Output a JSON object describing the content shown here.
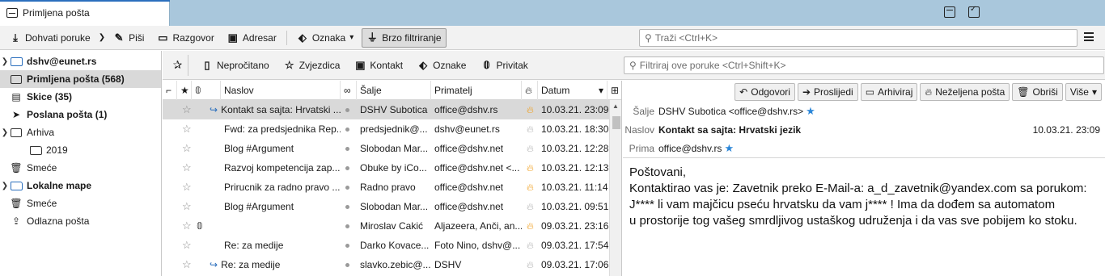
{
  "tab": {
    "title": "Primljena pošta"
  },
  "toolbar": {
    "get_messages": "Dohvati poruke",
    "write": "Piši",
    "chat": "Razgovor",
    "address_book": "Adresar",
    "tag": "Oznaka",
    "quick_filter": "Brzo filtriranje",
    "search_placeholder": "Traži <Ctrl+K>"
  },
  "folders": {
    "account": "dshv@eunet.rs",
    "inbox": "Primljena pošta (568)",
    "drafts": "Skice (35)",
    "sent": "Poslana pošta (1)",
    "archive": "Arhiva",
    "archive_2019": "2019",
    "trash": "Smeće",
    "local": "Lokalne mape",
    "local_trash": "Smeće",
    "outbox": "Odlazna pošta"
  },
  "quickfilter": {
    "unread": "Nepročitano",
    "starred": "Zvjezdica",
    "contact": "Kontakt",
    "tags": "Oznake",
    "attachment": "Privitak",
    "filter_placeholder": "Filtriraj ove poruke <Ctrl+Shift+K>"
  },
  "columns": {
    "subject": "Naslov",
    "sender": "Šalje",
    "recipient": "Primatelj",
    "date": "Datum"
  },
  "messages": [
    {
      "subject": "Kontakt sa sajta: Hrvatski ...",
      "sender": "DSHV Subotica",
      "recipient": "office@dshv.rs",
      "date": "10.03.21. 23:09",
      "replied": true,
      "junk": "hot"
    },
    {
      "subject": "Fwd: za predsjednika Rep...",
      "sender": "predsjednik@...",
      "recipient": "dshv@eunet.rs",
      "date": "10.03.21. 18:30",
      "replied": false,
      "junk": "cold"
    },
    {
      "subject": "Blog #Argument",
      "sender": "Slobodan Mar...",
      "recipient": "office@dshv.net",
      "date": "10.03.21. 12:28",
      "replied": false,
      "junk": "cold"
    },
    {
      "subject": "Razvoj kompetencija zap...",
      "sender": "Obuke by iCo...",
      "recipient": "office@dshv.net <...",
      "date": "10.03.21. 12:13",
      "replied": false,
      "junk": "hot"
    },
    {
      "subject": "Prirucnik za radno pravo ...",
      "sender": "Radno pravo",
      "recipient": "office@dshv.net",
      "date": "10.03.21. 11:14",
      "replied": false,
      "junk": "hot"
    },
    {
      "subject": "Blog #Argument",
      "sender": "Slobodan Mar...",
      "recipient": "office@dshv.net",
      "date": "10.03.21. 09:51",
      "replied": false,
      "junk": "cold"
    },
    {
      "subject": "",
      "sender": "Miroslav Cakić",
      "recipient": "Aljazeera, Anči, an...",
      "date": "09.03.21. 23:16",
      "replied": false,
      "junk": "hot",
      "attachment": true
    },
    {
      "subject": "Re: za medije",
      "sender": "Darko Kovace...",
      "recipient": "Foto Nino, dshv@...",
      "date": "09.03.21. 17:54",
      "replied": false,
      "junk": "cold"
    },
    {
      "subject": "Re: za medije",
      "sender": "slavko.zebic@...",
      "recipient": "DSHV",
      "date": "09.03.21. 17:06",
      "replied": true,
      "junk": "cold"
    }
  ],
  "message_view": {
    "buttons": {
      "reply": "Odgovori",
      "forward": "Proslijedi",
      "archive": "Arhiviraj",
      "junk": "Neželjena pošta",
      "delete": "Obriši",
      "more": "Više"
    },
    "from_label": "Šalje",
    "from": "DSHV Subotica <office@dshv.rs>",
    "subject_label": "Naslov",
    "subject": "Kontakt sa sajta: Hrvatski jezik",
    "date": "10.03.21. 23:09",
    "to_label": "Prima",
    "to": "office@dshv.rs",
    "body": [
      "Poštovani,",
      "Kontaktirao vas je: Zavetnik preko E-Mail-a: a_d_zavetnik@yandex.com sa porukom:",
      "J**** li vam majčicu pseću hrvatsku da vam j**** ! Ima da dođem sa automatom",
      "u prostorije tog vašeg smrdljivog ustaškog udruženja i da vas sve pobijem ko stoku."
    ]
  }
}
